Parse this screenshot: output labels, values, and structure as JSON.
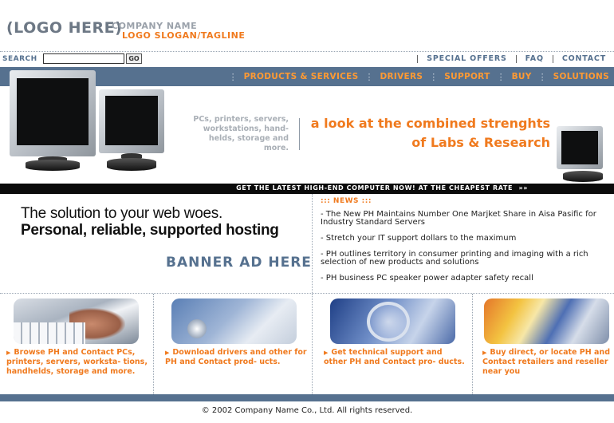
{
  "header": {
    "logo": "(LOGO HERE)",
    "company_name": "COMPANY NAME",
    "slogan": "LOGO SLOGAN/TAGLINE"
  },
  "search": {
    "label": "SEARCH",
    "value": "",
    "go_label": "GO"
  },
  "top_links": [
    "SPECIAL OFFERS",
    "FAQ",
    "CONTACT"
  ],
  "nav": {
    "items": [
      "PRODUCTS & SERVICES",
      "DRIVERS",
      "SUPPORT",
      "BUY",
      "SOLUTIONS"
    ]
  },
  "hero": {
    "small_text": [
      "PCs, printers, servers,",
      "workstations, hand-",
      "helds, storage and",
      "more."
    ],
    "headline_line1": "a look at the combined strenghts",
    "headline_line2": "of Labs & Research"
  },
  "strip": {
    "text": "GET THE LATEST HIGH-END COMPUTER NOW! AT THE CHEAPEST RATE",
    "arrows": "»»"
  },
  "promo": {
    "line1": "The solution to your web woes.",
    "line2": "Personal, reliable, supported hosting",
    "banner": "BANNER AD HERE"
  },
  "news": {
    "title": "::: NEWS :::",
    "items": [
      "- The New PH Maintains Number One Marjket Share in Aisa Pasific for Industry Standard Servers",
      "- Stretch your IT support dollars to the maximum",
      "- PH outlines territory in consumer printing and imaging with a rich selection of new products and solutions",
      "- PH business PC speaker power adapter safety recall"
    ]
  },
  "features": [
    {
      "icon": "keyboard-photo",
      "text": "Browse PH and Contact PCs, printers, servers, worksta- tions, handhelds, storage and more."
    },
    {
      "icon": "drive-photo",
      "text": "Download drivers and other for PH and Contact prod- ucts."
    },
    {
      "icon": "magnifier-photo",
      "text": "Get technical support and other PH and Contact pro- ducts."
    },
    {
      "icon": "color-stripes-photo",
      "text": "Buy direct, or locate PH and Contact retailers and reseller near you"
    }
  ],
  "footer": {
    "copyright": "© 2002 Company Name Co., Ltd. All rights reserved."
  },
  "colors": {
    "nav_blue": "#56718f",
    "accent_orange": "#f07a1e",
    "nav_orange": "#ff9a33",
    "strip_black": "#0b0b0b"
  }
}
